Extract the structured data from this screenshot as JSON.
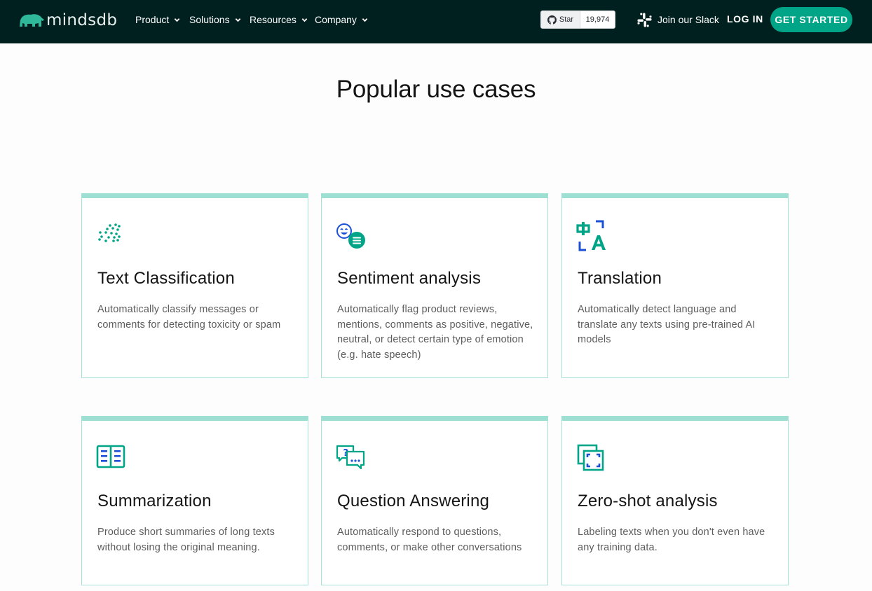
{
  "nav": {
    "brand": "mindsdb",
    "menu": [
      {
        "label": "Product"
      },
      {
        "label": "Solutions"
      },
      {
        "label": "Resources"
      },
      {
        "label": "Company"
      }
    ],
    "github": {
      "star_label": "Star",
      "count": "19,974"
    },
    "slack_label": "Join our Slack",
    "login_label": "LOG IN",
    "cta_label": "GET STARTED"
  },
  "colors": {
    "nav_bg": "#00201f",
    "accent": "#00a587",
    "card_top_border": "#9ddfd3",
    "icon_teal": "#00a587",
    "icon_blue": "#1a4fd6"
  },
  "section": {
    "title": "Popular use cases"
  },
  "cards": [
    {
      "icon": "dots-scatter-icon",
      "title": "Text Classification",
      "description": "Automatically classify messages or comments for detecting toxicity or spam"
    },
    {
      "icon": "emoji-chat-icon",
      "title": "Sentiment analysis",
      "description": "Automatically flag product reviews, mentions, comments as positive, negative, neutral, or detect certain type of emotion (e.g. hate speech)"
    },
    {
      "icon": "translate-icon",
      "title": "Translation",
      "description": "Automatically detect language and translate any texts using pre-trained AI models"
    },
    {
      "icon": "open-book-icon",
      "title": "Summarization",
      "description": "Produce short summaries of long texts without losing the original meaning."
    },
    {
      "icon": "question-chat-icon",
      "title": "Question Answering",
      "description": "Automatically respond to questions, comments, or make other conversations"
    },
    {
      "icon": "focus-frame-icon",
      "title": "Zero-shot analysis",
      "description": "Labeling texts when you don't even have any training data."
    }
  ]
}
